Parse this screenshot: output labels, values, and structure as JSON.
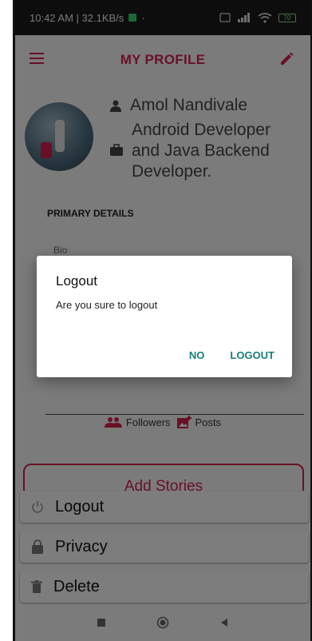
{
  "status_bar": {
    "time_speed": "10:42 AM | 32.1KB/s",
    "dot": "·",
    "battery": "70"
  },
  "app_bar": {
    "title": "MY PROFILE",
    "accent_color": "#d4204d"
  },
  "profile": {
    "name": "Amol Nandivale",
    "role": "Android Developer and Java Backend Developer."
  },
  "details": {
    "section_title": "PRIMARY DETAILS",
    "bio_label": "Bio"
  },
  "stats": {
    "followers_label": "Followers",
    "posts_label": "Posts"
  },
  "add_stories_label": "Add Stories",
  "bottom_menu": {
    "items": [
      {
        "label": "Logout",
        "icon": "power-icon"
      },
      {
        "label": "Privacy",
        "icon": "lock-icon"
      },
      {
        "label": "Delete",
        "icon": "trash-icon"
      }
    ]
  },
  "dialog": {
    "title": "Logout",
    "message": "Are you sure to logout",
    "negative": "NO",
    "positive": "LOGOUT",
    "button_color": "#167f7c"
  }
}
